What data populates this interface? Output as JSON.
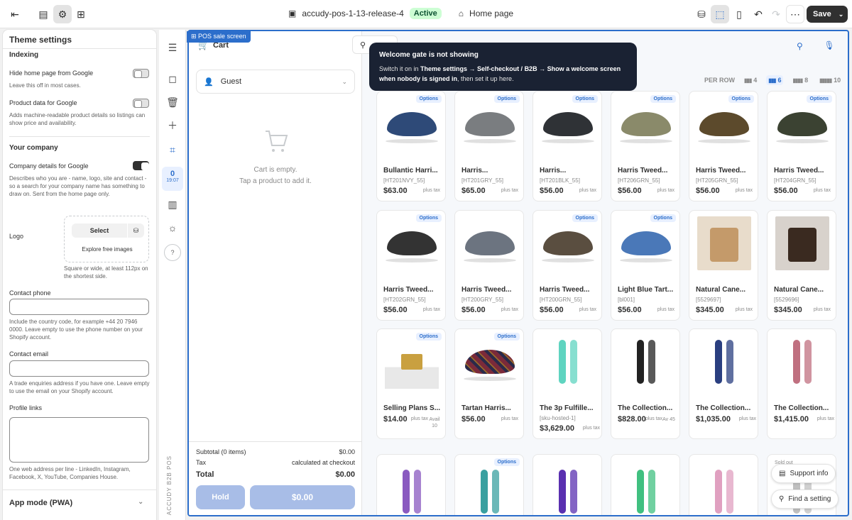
{
  "topbar": {
    "theme_name": "accudy-pos-1-13-release-4",
    "status": "Active",
    "page": "Home page",
    "save": "Save"
  },
  "sidebar": {
    "title": "Theme settings",
    "indexing_heading": "Indexing",
    "hide_home_label": "Hide home page from Google",
    "hide_home_help": "Leave this off in most cases.",
    "product_data_label": "Product data for Google",
    "product_data_help": "Adds machine-readable product details so listings can show price and availability.",
    "company_heading": "Your company",
    "company_details_label": "Company details for Google",
    "company_details_help": "Describes who you are - name, logo, site and contact - so a search for your company name has something to draw on. Sent from the home page only.",
    "logo_label": "Logo",
    "logo_select": "Select",
    "logo_explore": "Explore free images",
    "logo_help": "Square or wide, at least 112px on the shortest side.",
    "phone_label": "Contact phone",
    "phone_help": "Include the country code, for example +44 20 7946 0000. Leave empty to use the phone number on your Shopify account.",
    "email_label": "Contact email",
    "email_help": "A trade enquiries address if you have one. Leave empty to use the email on your Shopify account.",
    "profile_label": "Profile links",
    "profile_help": "One web address per line - LinkedIn, Instagram, Facebook, X, YouTube, Companies House.",
    "app_mode": "App mode (PWA)"
  },
  "rail": {
    "count": "0",
    "time": "19:07",
    "help": "?",
    "vertical": "ACCUDY B2B POS"
  },
  "pos": {
    "tag": "POS sale screen",
    "cart_title": "Cart",
    "guest": "Guest",
    "empty1": "Cart is empty.",
    "empty2": "Tap a product to add it.",
    "subtotal_label": "Subtotal (0 items)",
    "subtotal_value": "$0.00",
    "tax_label": "Tax",
    "tax_value": "calculated at checkout",
    "total_label": "Total",
    "total_value": "$0.00",
    "hold": "Hold",
    "pay": "$0.00",
    "per_row": "PER ROW",
    "per_row_options": [
      "4",
      "6",
      "8",
      "10"
    ],
    "options_badge": "Options",
    "plus_tax": "plus tax"
  },
  "tooltip": {
    "title": "Welcome gate is not showing",
    "body_pre": "Switch it on in ",
    "body_bold": "Theme settings → Self-checkout / B2B → Show a welcome screen when nobody is signed in",
    "body_post": ", then set it up here."
  },
  "products": [
    {
      "name": "Bullantic Harri...",
      "sku": "[HT201NVY_55]",
      "price": "$63.00",
      "options": true,
      "color": "#2e4a78"
    },
    {
      "name": "Harris...",
      "sku": "[HT201GRY_55]",
      "price": "$65.00",
      "options": true,
      "color": "#7a7d80"
    },
    {
      "name": "Harris...",
      "sku": "[HT201BLK_55]",
      "price": "$56.00",
      "options": true,
      "color": "#2f3236"
    },
    {
      "name": "Harris Tweed...",
      "sku": "[HT206GRN_55]",
      "price": "$56.00",
      "options": true,
      "color": "#8a8a6a"
    },
    {
      "name": "Harris Tweed...",
      "sku": "[HT205GRN_55]",
      "price": "$56.00",
      "options": true,
      "color": "#5c4a2c"
    },
    {
      "name": "Harris Tweed...",
      "sku": "[HT204GRN_55]",
      "price": "$56.00",
      "options": true,
      "color": "#3b4232"
    },
    {
      "name": "Harris Tweed...",
      "sku": "[HT202GRN_55]",
      "price": "$56.00",
      "options": true,
      "color": "#333"
    },
    {
      "name": "Harris Tweed...",
      "sku": "[HT200GRY_55]",
      "price": "$56.00",
      "options": false,
      "color": "#6c7480"
    },
    {
      "name": "Harris Tweed...",
      "sku": "[HT200GRN_55]",
      "price": "$56.00",
      "options": true,
      "color": "#5a4e40"
    },
    {
      "name": "Light Blue Tart...",
      "sku": "[bl001]",
      "price": "$56.00",
      "options": true,
      "color": "#4a78b8"
    },
    {
      "name": "Natural Cane...",
      "sku": "[5529697]",
      "price": "$345.00",
      "options": false,
      "color": "#c49a6a"
    },
    {
      "name": "Natural Cane...",
      "sku": "[5529696]",
      "price": "$345.00",
      "options": false,
      "color": "#3a2a20"
    },
    {
      "name": "Selling Plans S...",
      "sku": "",
      "price": "$14.00",
      "options": true,
      "color": "#c9a040",
      "avail": "Avail 10"
    },
    {
      "name": "Tartan Harris...",
      "sku": "",
      "price": "$56.00",
      "options": true,
      "color": "#7a2a3a"
    },
    {
      "name": "The 3p Fulfille...",
      "sku": "[sku-hosted-1]",
      "price": "$3,629.00",
      "options": false,
      "color": "#5fd4c0"
    },
    {
      "name": "The Collection...",
      "sku": "",
      "price": "$828.00",
      "options": false,
      "color": "#222",
      "avail": "Av 45"
    },
    {
      "name": "The Collection...",
      "sku": "",
      "price": "$1,035.00",
      "options": false,
      "color": "#2a3f80"
    },
    {
      "name": "The Collection...",
      "sku": "",
      "price": "$1,415.00",
      "options": false,
      "color": "#c07080"
    },
    {
      "name": "",
      "sku": "",
      "price": "",
      "options": false,
      "color": "#8a5ac0"
    },
    {
      "name": "",
      "sku": "",
      "price": "",
      "options": true,
      "color": "#3aa0a0"
    },
    {
      "name": "",
      "sku": "",
      "price": "",
      "options": false,
      "color": "#5a30b0"
    },
    {
      "name": "",
      "sku": "",
      "price": "",
      "options": false,
      "color": "#40c080"
    },
    {
      "name": "",
      "sku": "",
      "price": "",
      "options": false,
      "color": "#e0a0c0"
    },
    {
      "name": "",
      "sku": "",
      "price": "",
      "options": false,
      "color": "#c0c0c0",
      "soldout": "Sold out"
    }
  ],
  "floating": {
    "support": "Support info",
    "find": "Find a setting"
  }
}
